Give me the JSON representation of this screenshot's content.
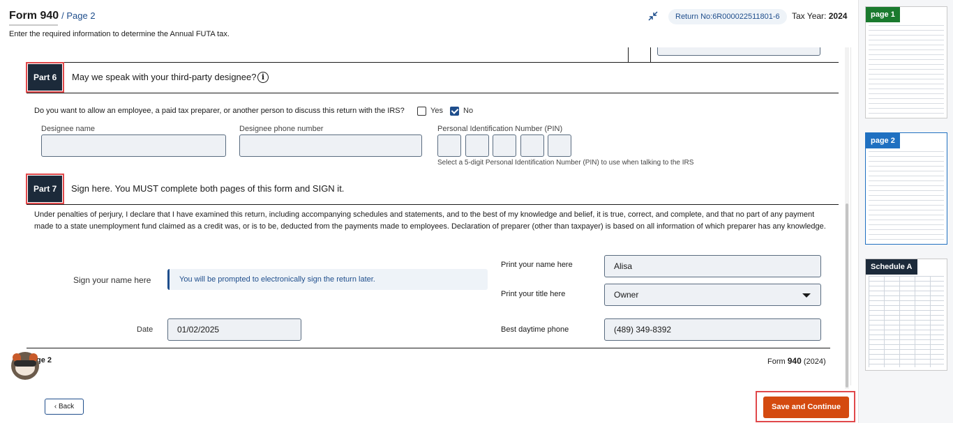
{
  "header": {
    "form_title": "Form 940",
    "page_sub": "/ Page 2",
    "subtitle": "Enter the required information to determine the Annual FUTA tax.",
    "return_no": "Return No:6R000022511801-6",
    "tax_year_label": "Tax Year:",
    "tax_year_value": "2024"
  },
  "part6": {
    "badge": "Part 6",
    "title": "May we speak with your third-party designee?",
    "question": "Do you want to allow an employee, a paid tax preparer, or another person to discuss this return with the IRS?",
    "yes_label": "Yes",
    "no_label": "No",
    "yes_checked": false,
    "no_checked": true,
    "designee_name_label": "Designee name",
    "designee_name_value": "",
    "designee_phone_label": "Designee phone number",
    "designee_phone_value": "",
    "pin_label": "Personal Identification Number (PIN)",
    "pin_help": "Select a 5-digit Personal Identification Number (PIN) to use when talking to the IRS"
  },
  "part7": {
    "badge": "Part 7",
    "title": "Sign here. You MUST complete both pages of this form and SIGN it.",
    "declaration": "Under penalties of perjury, I declare that I have examined this return, including accompanying schedules and statements, and to the best of my knowledge and belief, it is true, correct, and complete, and that no part of any payment made to a state unemployment fund claimed as a credit was, or is to be, deducted from the payments made to employees. Declaration of preparer (other than taxpayer) is based on all information of which preparer has any knowledge.",
    "sign_label": "Sign your name here",
    "sign_notice": "You will be prompted to electronically sign the return later.",
    "print_name_label": "Print your name here",
    "print_name_value": "Alisa",
    "print_title_label": "Print your title here",
    "print_title_value": "Owner",
    "date_label": "Date",
    "date_value": "01/02/2025",
    "phone_label": "Best daytime phone",
    "phone_value": "(489) 349-8392"
  },
  "footer": {
    "page_left": "ge 2",
    "form_right_prefix": "Form ",
    "form_right_bold": "940",
    "form_right_suffix": " (2024)",
    "back_label": "Back",
    "save_label": "Save and Continue"
  },
  "rail": {
    "thumbs": [
      {
        "label": "page 1",
        "color": "#1a7a2e"
      },
      {
        "label": "page 2",
        "color": "#1f70c1"
      },
      {
        "label": "Schedule A",
        "color": "#1c2a3a"
      }
    ]
  },
  "colors": {
    "accent": "#1f4e8c",
    "save_button": "#d44a0f",
    "highlight": "#e0484a",
    "part_badge": "#1c2a3a"
  }
}
